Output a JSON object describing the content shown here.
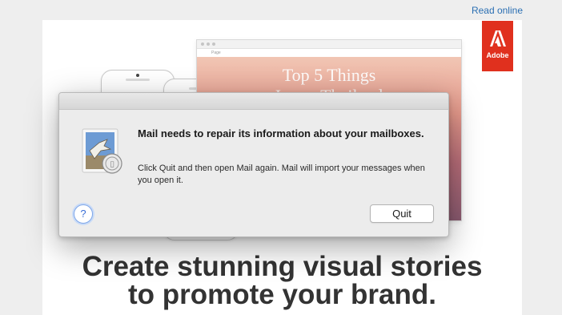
{
  "email": {
    "read_online": "Read online",
    "brand_word": "Adobe",
    "brand_color": "#e0301e",
    "preview_page_tab": "Page",
    "hero_title": "Top 5 Things",
    "hero_subtitle": "I ... ... Thailand",
    "headline_line1": "Create stunning visual stories",
    "headline_line2": "to promote your brand."
  },
  "dialog": {
    "icon": "mail-stamp-icon",
    "title": "Mail needs to repair its information about your mailboxes.",
    "body": "Click Quit and then open Mail again. Mail will import your messages when you open it.",
    "help_symbol": "?",
    "quit_label": "Quit"
  }
}
